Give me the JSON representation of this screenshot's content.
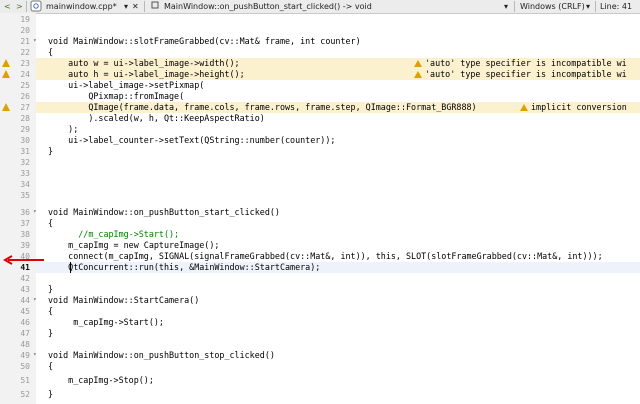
{
  "editor_toolbar": {
    "nav_back_glyph": "<",
    "nav_forward_glyph": ">",
    "file_tab": "mainwindow.cpp*",
    "function_selector": "MainWindow::on_pushButton_start_clicked() -> void",
    "encoding": "Windows (CRLF)",
    "position": "Line: 41"
  },
  "lines": [
    {
      "n": "19",
      "text": ""
    },
    {
      "n": "20",
      "text": ""
    },
    {
      "n": "21",
      "text": "void MainWindow::slotFrameGrabbed(cv::Mat& frame, int counter)"
    },
    {
      "n": "22",
      "text": "{"
    },
    {
      "n": "23",
      "text": "    auto w = ui->label_image->width();"
    },
    {
      "n": "24",
      "text": "    auto h = ui->label_image->height();"
    },
    {
      "n": "25",
      "text": "    ui->label_image->setPixmap("
    },
    {
      "n": "26",
      "text": "        QPixmap::fromImage("
    },
    {
      "n": "27",
      "text": "        QImage(frame.data, frame.cols, frame.rows, frame.step, QImage::Format_BGR888)"
    },
    {
      "n": "28",
      "text": "        ).scaled(w, h, Qt::KeepAspectRatio)"
    },
    {
      "n": "29",
      "text": "    );"
    },
    {
      "n": "30",
      "text": "    ui->label_counter->setText(QString::number(counter));"
    },
    {
      "n": "31",
      "text": "}"
    },
    {
      "n": "32",
      "text": ""
    },
    {
      "n": "33",
      "text": ""
    },
    {
      "n": "34",
      "text": ""
    },
    {
      "n": "35",
      "text": ""
    },
    {
      "n": "36",
      "text": "void MainWindow::on_pushButton_start_clicked()"
    },
    {
      "n": "37",
      "text": "{"
    },
    {
      "n": "38",
      "text": "      //m_capImg->Start();"
    },
    {
      "n": "39",
      "text": "    m_capImg = new CaptureImage();"
    },
    {
      "n": "40",
      "text": "    connect(m_capImg, SIGNAL(signalFrameGrabbed(cv::Mat&, int)), this, SLOT(slotFrameGrabbed(cv::Mat&, int)));"
    },
    {
      "n": "41",
      "text": "    QtConcurrent::run(this, &MainWindow::StartCamera);"
    },
    {
      "n": "42",
      "text": ""
    },
    {
      "n": "43",
      "text": "}"
    },
    {
      "n": "44",
      "text": "void MainWindow::StartCamera()"
    },
    {
      "n": "45",
      "text": "{"
    },
    {
      "n": "46",
      "text": "     m_capImg->Start();"
    },
    {
      "n": "47",
      "text": "}"
    },
    {
      "n": "48",
      "text": ""
    },
    {
      "n": "49",
      "text": "void MainWindow::on_pushButton_stop_clicked()"
    },
    {
      "n": "50",
      "text": "{"
    },
    {
      "n": "51",
      "text": "    m_capImg->Stop();"
    },
    {
      "n": "52",
      "text": "}"
    }
  ],
  "warnings": [
    {
      "line": "23",
      "message": "'auto' type specifier is incompatible wi"
    },
    {
      "line": "24",
      "message": "'auto' type specifier is incompatible wi"
    },
    {
      "line": "27",
      "message": "implicit conversion"
    }
  ],
  "colors": {
    "warning": "#e0a000",
    "arrow": "#e00000",
    "current_line": "#eef3fb"
  }
}
